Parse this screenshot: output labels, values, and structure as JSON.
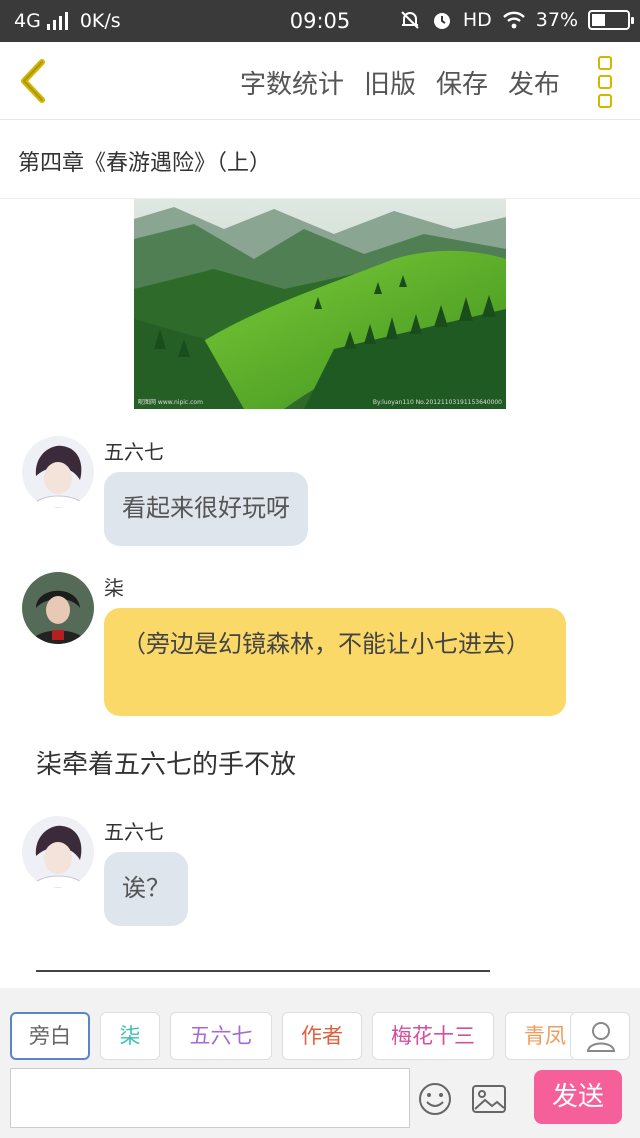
{
  "status_bar": {
    "network": "4G",
    "speed": "0K/s",
    "time": "09:05",
    "hd": "HD",
    "battery_percent": "37%",
    "battery_level": 0.37,
    "icons": [
      "signal-icon",
      "mute-bell-icon",
      "alarm-icon",
      "wifi-icon",
      "battery-icon"
    ]
  },
  "toolbar": {
    "back_icon": "chevron-left-icon",
    "actions": [
      "字数统计",
      "旧版",
      "保存",
      "发布"
    ],
    "more_icon": "more-vertical-icon",
    "accent_color": "#d4b500"
  },
  "chapter_title": "第四章《春游遇险》（上）",
  "scene_image": {
    "caption_left": "昵图网 www.nipic.com",
    "caption_right": "By:luoyan110 No.20121103191153640000"
  },
  "messages": [
    {
      "speaker": "五六七",
      "text": "看起来很好玩呀",
      "style": "grey"
    },
    {
      "speaker": "柒",
      "text": "（旁边是幻镜森林，不能让小七进去）",
      "style": "yellow"
    },
    {
      "narration": "柒牵着五六七的手不放"
    },
    {
      "speaker": "五六七",
      "text": "诶？",
      "style": "grey"
    }
  ],
  "roles": [
    {
      "label": "旁白",
      "color": "#666666",
      "active": true
    },
    {
      "label": "柒",
      "color": "#3cbfae",
      "active": false
    },
    {
      "label": "五六七",
      "color": "#a46bd1",
      "active": false
    },
    {
      "label": "作者",
      "color": "#e0603c",
      "active": false
    },
    {
      "label": "梅花十三",
      "color": "#d44ea0",
      "active": false
    },
    {
      "label": "青凤",
      "color": "#ee9c5c",
      "active": false
    }
  ],
  "composer": {
    "input_value": "",
    "user_icon": "user-icon",
    "emoji_icon": "emoji-icon",
    "image_icon": "image-icon",
    "send_label": "发送",
    "send_color": "#f5609a"
  }
}
